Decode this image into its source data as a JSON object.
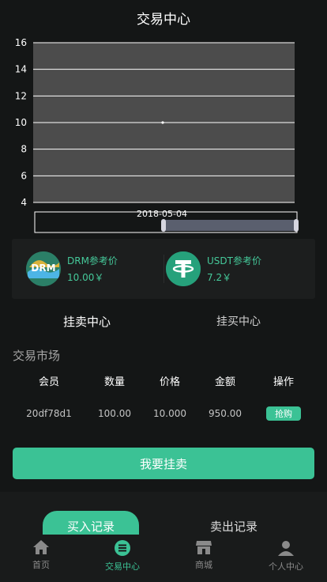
{
  "header": {
    "title": "交易中心"
  },
  "chart_data": {
    "type": "scatter",
    "x": [
      "2018-05-04"
    ],
    "values": [
      10
    ],
    "yticks": [
      "16",
      "14",
      "12",
      "10",
      "8",
      "6",
      "4"
    ],
    "ylim": [
      4,
      16
    ],
    "grid": true,
    "range_slider_label": "2018-05-04"
  },
  "reference": {
    "drm": {
      "label": "DRM参考价",
      "price": "10.00￥",
      "logo_text": "DRM"
    },
    "usdt": {
      "label": "USDT参考价",
      "price": "7.2￥",
      "logo_text": "T"
    }
  },
  "tabs": {
    "sell_center": "挂卖中心",
    "buy_center": "挂买中心"
  },
  "market": {
    "title": "交易市场",
    "headers": [
      "会员",
      "数量",
      "价格",
      "金额",
      "操作"
    ],
    "rows": [
      {
        "member": "20df78d1",
        "quantity": "100.00",
        "price": "10.000",
        "amount": "950.00",
        "action": "抢购"
      }
    ]
  },
  "actions": {
    "primary": "我要挂卖"
  },
  "records": {
    "buy_tab": "买入记录",
    "sell_tab": "卖出记录"
  },
  "nav": {
    "items": [
      {
        "label": "首页",
        "icon": "home-icon"
      },
      {
        "label": "交易中心",
        "icon": "trade-icon"
      },
      {
        "label": "商城",
        "icon": "store-icon"
      },
      {
        "label": "个人中心",
        "icon": "user-icon"
      }
    ]
  },
  "colors": {
    "accent": "#3bc295",
    "background": "#141616",
    "plot_bg": "#4c4c4c"
  }
}
